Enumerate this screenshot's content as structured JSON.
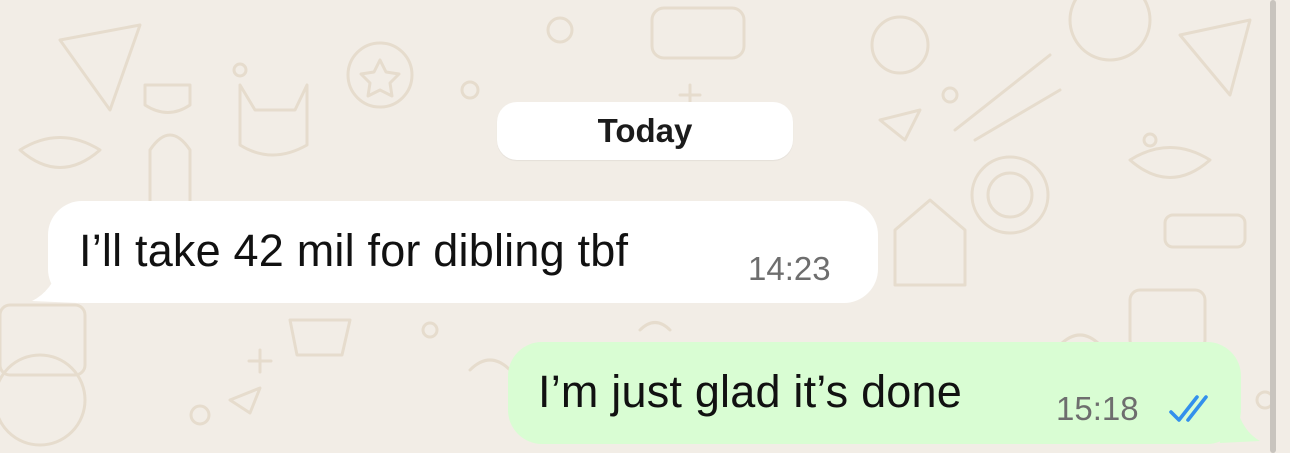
{
  "chat": {
    "date_separator": "Today",
    "messages": [
      {
        "direction": "incoming",
        "text": "I’ll take 42 mil for dibling tbf",
        "time": "14:23"
      },
      {
        "direction": "outgoing",
        "text": "I’m just glad it’s done",
        "time": "15:18",
        "status_icon": "double-check-read-icon"
      }
    ]
  },
  "colors": {
    "wallpaper": "#f2ede6",
    "wallpaper_doodle": "#e4d8c8",
    "incoming_bubble": "#ffffff",
    "outgoing_bubble": "#d9fdd3",
    "read_ticks": "#3390ec",
    "timestamp": "#6e6e6e"
  }
}
